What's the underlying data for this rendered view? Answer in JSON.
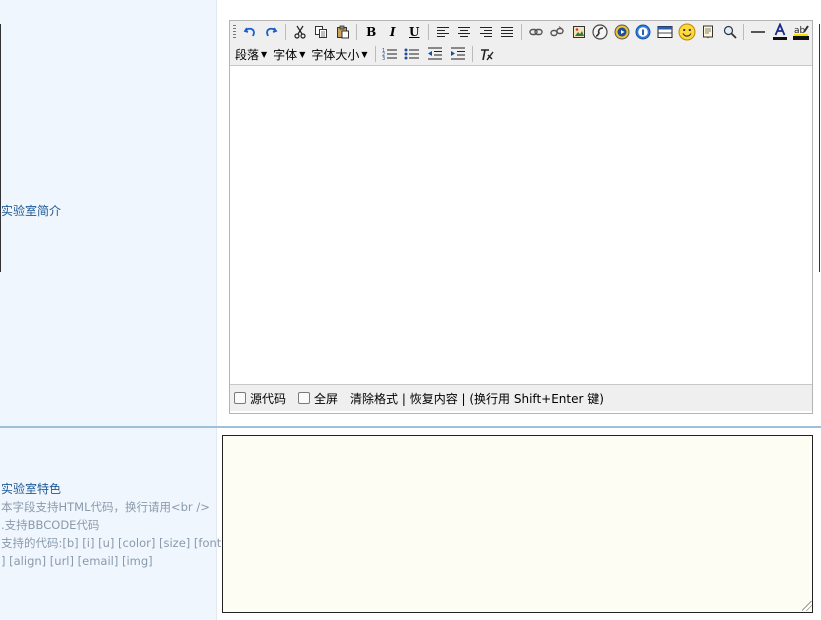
{
  "row1": {
    "title": "实验室简介",
    "toolbar": {
      "row1_icons": [
        "undo-icon",
        "redo-icon",
        "cut-icon",
        "copy-icon",
        "paste-icon",
        "bold-icon",
        "italic-icon",
        "underline-icon",
        "align-left-icon",
        "align-center-icon",
        "align-right-icon",
        "align-justify-icon",
        "link-icon",
        "unlink-icon",
        "image-icon",
        "flash-icon",
        "media-icon",
        "info-icon",
        "table-icon",
        "smiley-icon",
        "page-icon",
        "search-icon",
        "hr-icon",
        "font-color-icon",
        "highlight-icon"
      ],
      "bold_glyph": "B",
      "italic_glyph": "I",
      "underline_glyph": "U",
      "paragraph_label": "段落",
      "font_label": "字体",
      "font_size_label": "字体大小"
    },
    "footer": {
      "source_label": "源代码",
      "fullscreen_label": "全屏",
      "links_text": "清除格式 | 恢复内容 | (换行用 Shift+Enter 键)"
    }
  },
  "row2": {
    "title": "实验室特色",
    "hint_lines": [
      "本字段支持HTML代码，换行请用<br />",
      ".支持BBCODE代码",
      "支持的代码:[b] [i] [u] [color] [size] [font",
      "] [align] [url] [email] [img]"
    ],
    "textarea_value": ""
  },
  "colors": {
    "label_bg": "#f0f6fd",
    "label_text": "#1d5a96",
    "hint_text": "#8a9aac",
    "divider": "#9fc0d8",
    "toolbar_bg": "#efefef",
    "textarea_bg": "#fdfdf3"
  }
}
